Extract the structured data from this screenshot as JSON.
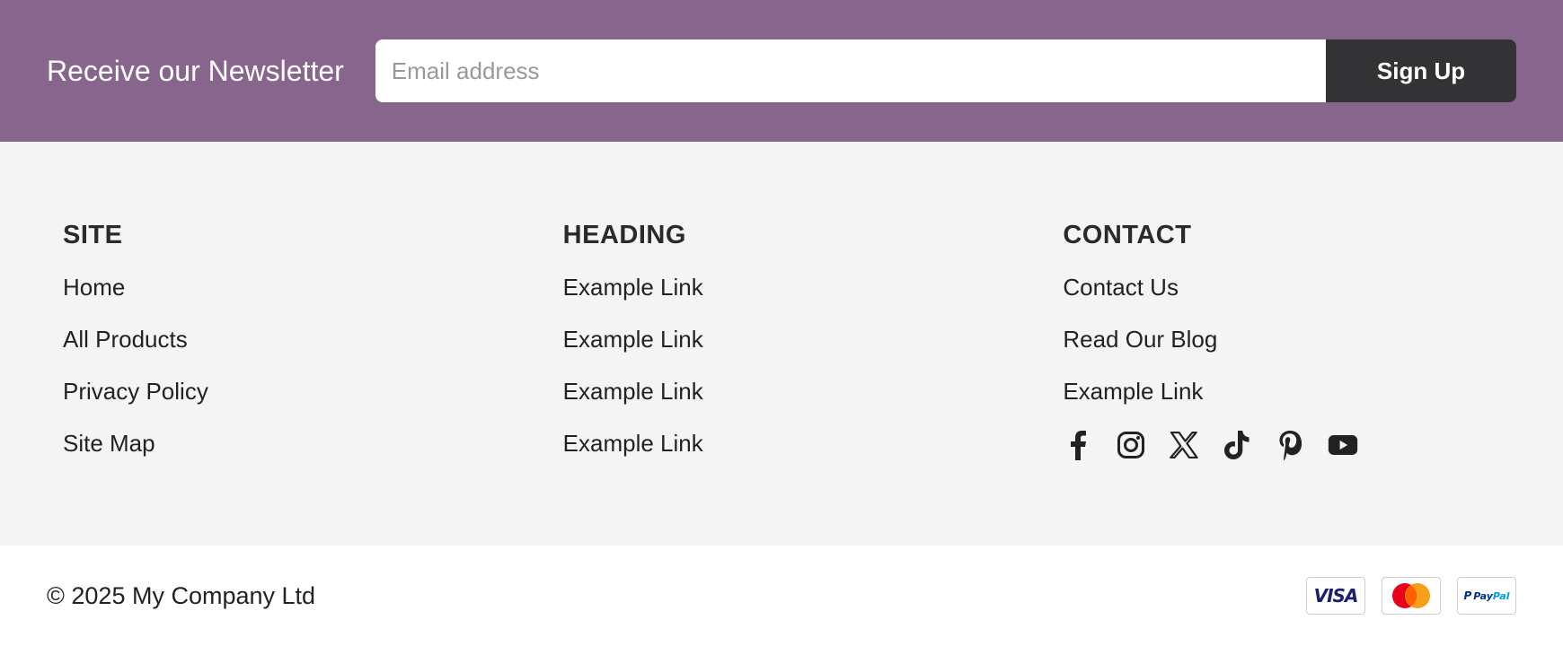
{
  "newsletter": {
    "title": "Receive our Newsletter",
    "email_placeholder": "Email address",
    "email_value": "",
    "submit_label": "Sign Up",
    "background_color": "#88658c",
    "button_color": "#333336"
  },
  "footer": {
    "background_color": "#f4f4f4",
    "columns": [
      {
        "heading": "SITE",
        "links": [
          "Home",
          "All Products",
          "Privacy Policy",
          "Site Map"
        ]
      },
      {
        "heading": "HEADING",
        "links": [
          "Example Link",
          "Example Link",
          "Example Link",
          "Example Link"
        ]
      },
      {
        "heading": "CONTACT",
        "links": [
          "Contact Us",
          "Read Our Blog",
          "Example Link"
        ]
      }
    ],
    "social_icons": [
      "facebook-icon",
      "instagram-icon",
      "x-icon",
      "tiktok-icon",
      "pinterest-icon",
      "youtube-icon"
    ]
  },
  "bottom": {
    "copyright": "© 2025 My Company Ltd",
    "payment_methods": {
      "visa": "VISA",
      "mastercard": "mastercard-icon",
      "paypal_a": "Pay",
      "paypal_b": "Pal"
    }
  }
}
